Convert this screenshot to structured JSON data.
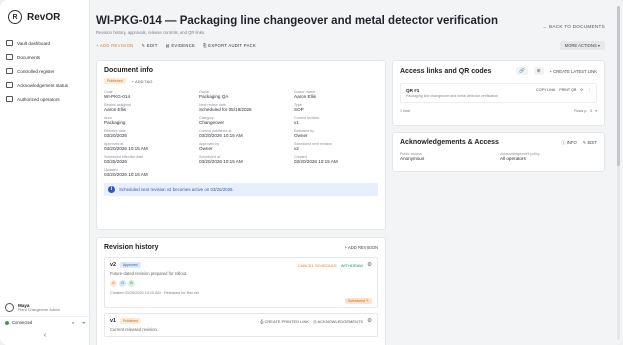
{
  "app": {
    "name": "RevOR"
  },
  "sidebar": {
    "items": [
      {
        "label": "Vault dashboard"
      },
      {
        "label": "Documents"
      },
      {
        "label": "Controlled register"
      },
      {
        "label": "Acknowledgement status"
      },
      {
        "label": "Authorized operators"
      }
    ],
    "user": {
      "name": "Maya",
      "sub": "Plant Changeover Admin"
    },
    "connection": "Connected",
    "collapse_icon": "‹"
  },
  "header": {
    "title": "WI-PKG-014 — Packaging line changeover and metal detector verification",
    "subtitle": "Revision history, approvals, release controls, and QR links.",
    "back_label": "← BACK TO DOCUMENTS"
  },
  "toolbar": {
    "add_revision": "+ ADD REVISION",
    "edit": "✎ EDIT",
    "evidence": "▤ EVIDENCE",
    "export": "⎘ EXPORT AUDIT PACK",
    "more": "MORE ACTIONS ▾"
  },
  "doc_info": {
    "title": "Document info",
    "status_badge": "Published",
    "add_tag": "+ ADD TAG",
    "fields": [
      {
        "label": "Code",
        "value": "WI-PKG-014"
      },
      {
        "label": "Owner",
        "value": "Packaging QA"
      },
      {
        "label": "Doctor owner",
        "value": "Aaron Ellis"
      },
      {
        "label": "Review assigned",
        "value": "Aaron Ellis"
      },
      {
        "label": "Next review date",
        "value": "Scheduled for 05/19/2026"
      },
      {
        "label": "Type",
        "value": "SOP"
      },
      {
        "label": "Area",
        "value": "Packaging"
      },
      {
        "label": "Category",
        "value": "Changeover"
      },
      {
        "label": "Current revision",
        "value": "v1"
      },
      {
        "label": "Effective date",
        "value": "03/20/2026"
      },
      {
        "label": "Current published at",
        "value": "03/20/2026 10:15 AM"
      },
      {
        "label": "Released by",
        "value": "Owner"
      },
      {
        "label": "Approved at",
        "value": "03/20/2026 10:15 AM"
      },
      {
        "label": "Approved by",
        "value": "Owner"
      },
      {
        "label": "Scheduled next revision",
        "value": "v2"
      },
      {
        "label": "Scheduled effective date",
        "value": "03/25/2026"
      },
      {
        "label": "Scheduled at",
        "value": "03/20/2026 10:15 AM"
      },
      {
        "label": "Created",
        "value": "03/20/2026 10:15 AM"
      },
      {
        "label": "Updated",
        "value": "03/20/2026 10:16 AM"
      }
    ],
    "info_message": "Scheduled next revision v2 becomes active on 03/25/2026."
  },
  "revision_history": {
    "title": "Revision history",
    "add_label": "+ ADD REVISION",
    "items": [
      {
        "num": "v2",
        "badge": "Approved",
        "summary": "Future-dated revision prepared for rollout.",
        "cancel": "CANCEL SCHEDULE",
        "withdraw": "WITHDRAW",
        "created": "Created 03/20/2026 10:15 AM · Released for first set",
        "scheduled": "Scheduled ✎",
        "avatars": [
          "A",
          "O",
          "B"
        ]
      },
      {
        "num": "v1",
        "badge": "Published",
        "summary": "Current released revision.",
        "printed": "⎙ CREATE PRINTED LINK",
        "acks": "◎ ACKNOWLEDGEMENTS"
      }
    ]
  },
  "access": {
    "title": "Access links and QR codes",
    "create_label": "+ CREATE LATEST LINK",
    "qr": {
      "title": "QR #1",
      "sub": "Packaging line changeover and metal detector verification",
      "copy": "COPY LINK",
      "print": "PRINT QR"
    },
    "total": "1 total",
    "rows_label": "Rows p.",
    "rows_value": "5"
  },
  "ack": {
    "title": "Acknowledgements & Access",
    "info_btn": "ⓘ INFO",
    "edit_btn": "✎ EDIT",
    "public_label": "Public access",
    "public_value": "Anonymous",
    "policy_label": "Acknowledgement policy",
    "policy_value": "All operators"
  },
  "colors": {
    "accent": "#e07b2a",
    "info": "#3358b8",
    "success": "#2d8b55"
  }
}
